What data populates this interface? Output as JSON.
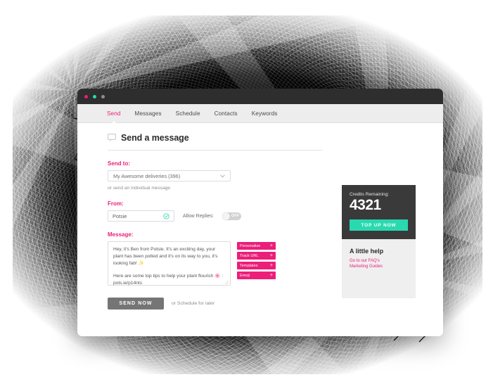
{
  "window": {
    "traffic_lights": [
      {
        "name": "close",
        "color": "#ec1e79"
      },
      {
        "name": "minimize",
        "color": "#2ad9b0"
      },
      {
        "name": "maximize",
        "color": "#8d8d8d"
      }
    ]
  },
  "nav": {
    "items": [
      {
        "label": "Send",
        "active": true
      },
      {
        "label": "Messages",
        "active": false
      },
      {
        "label": "Schedule",
        "active": false
      },
      {
        "label": "Contacts",
        "active": false
      },
      {
        "label": "Keywords",
        "active": false
      }
    ]
  },
  "page": {
    "title": "Send a message",
    "icon": "speech-bubble-icon"
  },
  "send_to": {
    "label": "Send to:",
    "selected_option": "My Awesome deliveries (396)",
    "options": [
      "My Awesome deliveries (396)"
    ],
    "hint": "or send an individual message"
  },
  "from": {
    "label": "From:",
    "value": "Potsie",
    "verified_icon": "check-circle-icon",
    "allow_replies_label": "Allow Replies:",
    "allow_replies_state": "OFF"
  },
  "message": {
    "label": "Message:",
    "paragraphs": [
      "Hey, it's Ben from Potsie. It's an exciting day, your plant has been potted and it's on its way to you, it's looking fab! ✨",
      "Here are some top tips to help your plant flourish 🌸 : pots.ie/p14nts"
    ],
    "tools": [
      {
        "label": "Personalise",
        "add": "+"
      },
      {
        "label": "Track URL",
        "add": "+"
      },
      {
        "label": "Templates",
        "add": "+"
      },
      {
        "label": "Emoji",
        "add": "+"
      }
    ]
  },
  "actions": {
    "send_label": "SEND NOW",
    "schedule_label": "or Schedule for later"
  },
  "sidebar": {
    "credits_label": "Credits Remaining:",
    "credits_value": "4321",
    "topup_label": "TOP UP NOW",
    "help_title": "A little help",
    "help_links": [
      "Go to our FAQ's",
      "Marketing Guides"
    ]
  },
  "colors": {
    "accent_pink": "#ec1e79",
    "accent_teal": "#2ad9b0",
    "dark_panel": "#3a3a3a",
    "send_button": "#757575"
  }
}
